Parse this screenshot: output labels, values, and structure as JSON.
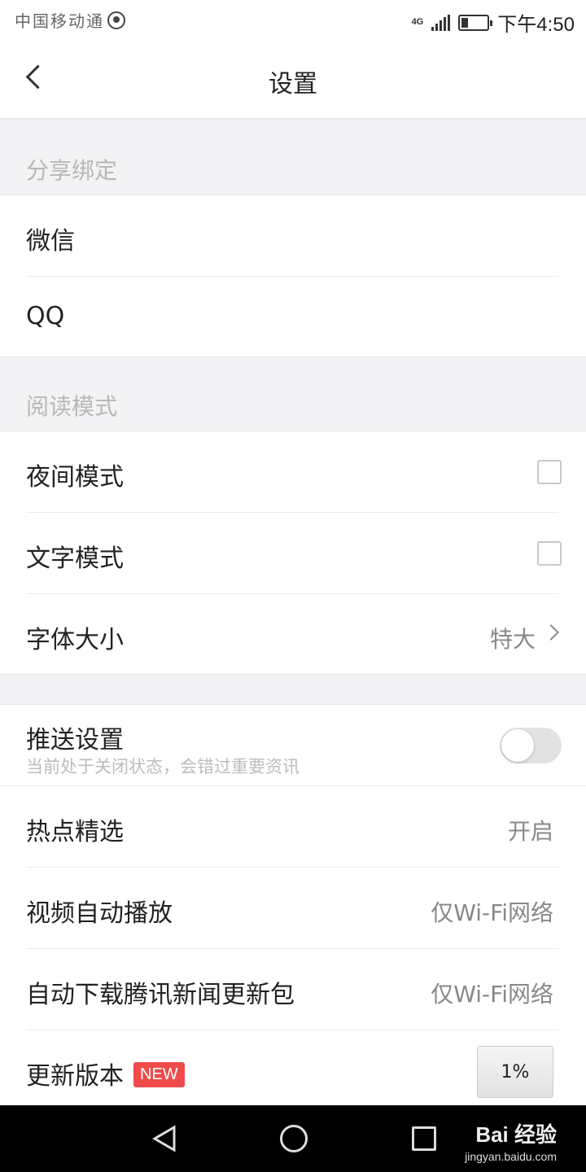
{
  "status_bar": {
    "carrier": "中国移动通",
    "network": "4G",
    "time": "下午4:50"
  },
  "header": {
    "title": "设置",
    "back_icon": "chevron-left-icon"
  },
  "sections": {
    "share": {
      "label": "分享绑定",
      "rows": [
        {
          "label": "微信",
          "value": ""
        },
        {
          "label": "QQ",
          "value": ""
        }
      ]
    },
    "reading": {
      "label": "阅读模式",
      "rows": [
        {
          "label": "夜间模式",
          "checked": false
        },
        {
          "label": "文字模式",
          "checked": false
        },
        {
          "label": "字体大小",
          "value": "特大"
        }
      ]
    },
    "other": {
      "push": {
        "label": "推送设置",
        "sub": "当前处于关闭状态，会错过重要资讯",
        "on": false
      },
      "hot": {
        "label": "热点精选",
        "value": "开启"
      },
      "video": {
        "label": "视频自动播放",
        "value": "仅Wi-Fi网络"
      },
      "download": {
        "label": "自动下载腾讯新闻更新包",
        "value": "仅Wi-Fi网络"
      },
      "update": {
        "label": "更新版本",
        "badge": "NEW",
        "progress": "1%"
      }
    }
  },
  "watermark": {
    "brand": "Bai 经验",
    "site": "jingyan.baidu.com"
  },
  "colors": {
    "badge": "#f04b4b",
    "label_gray": "#b8b8b8"
  }
}
